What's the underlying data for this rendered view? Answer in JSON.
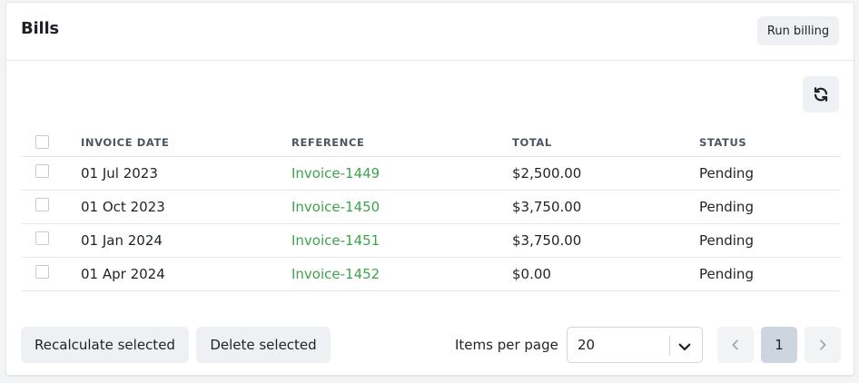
{
  "header": {
    "title": "Bills",
    "run_billing_label": "Run billing"
  },
  "toolbar": {
    "refresh_icon": "refresh-icon"
  },
  "table": {
    "columns": [
      "INVOICE DATE",
      "REFERENCE",
      "TOTAL",
      "STATUS"
    ],
    "rows": [
      {
        "date": "01 Jul 2023",
        "reference": "Invoice-1449",
        "total": "$2,500.00",
        "status": "Pending"
      },
      {
        "date": "01 Oct 2023",
        "reference": "Invoice-1450",
        "total": "$3,750.00",
        "status": "Pending"
      },
      {
        "date": "01 Jan 2024",
        "reference": "Invoice-1451",
        "total": "$3,750.00",
        "status": "Pending"
      },
      {
        "date": "01 Apr 2024",
        "reference": "Invoice-1452",
        "total": "$0.00",
        "status": "Pending"
      }
    ]
  },
  "footer": {
    "recalculate_label": "Recalculate selected",
    "delete_label": "Delete selected",
    "items_per_page_label": "Items per page",
    "items_per_page_value": "20",
    "current_page": "1"
  },
  "colors": {
    "link": "#3fa34d",
    "button_bg": "#eef0f3",
    "current_page_bg": "#cdd5df"
  }
}
